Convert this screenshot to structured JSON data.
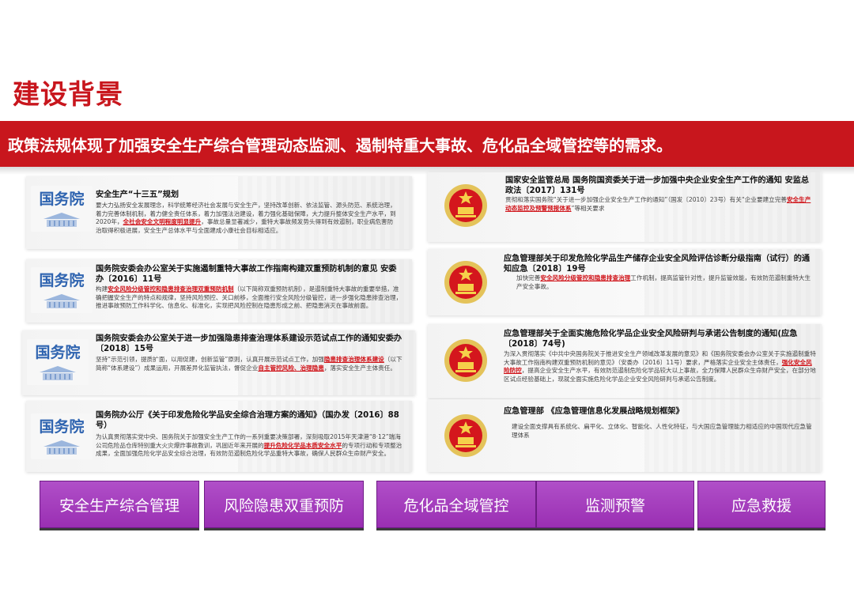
{
  "page": {
    "title": "建设背景",
    "banner": "政策法规体现了加强安全生产综合管理动态监测、遏制特重大事故、危化品全域管控等的需求。"
  },
  "left_cards": [
    {
      "badge": "国务院",
      "title": "安全生产“十三五”规划",
      "body_parts": [
        {
          "t": "要大力弘扬安全发展理念，科学统筹经济社会发展与安全生产，坚持改革创新、依法监管、源头防范、系统治理，着力完善体制机制，着力健全责任体系，着力加强法治建设，着力强化基础保障，大力提升整体安全生产水平，到2020年，",
          "red": false
        },
        {
          "t": "全社会安全文明程度明显提升",
          "red": true
        },
        {
          "t": "，事故总量显著减少，重特大事故频发势头得到有效遏制，职业病危害防治取得积极进展，安全生产总体水平与全面建成小康社会目标相适应。",
          "red": false
        }
      ]
    },
    {
      "badge": "国务院",
      "title": "国务院安委会办公室关于实施遏制重特大事故工作指南构建双重预防机制的意见 安委办〔2016〕11号",
      "body_parts": [
        {
          "t": "构建",
          "red": false
        },
        {
          "t": "安全风险分级管控和隐患排查治理双重预防机制",
          "red": true
        },
        {
          "t": "（以下简称双重预防机制），是遏制重特大事故的重要举措，准确把握安全生产的特点和规律，坚持风险预控、关口前移，全面推行安全风险分级管控，进一步强化隐患排查治理，推进事故预防工作科学化、信息化、标准化，实现把风险控制在隐患形成之前、把隐患消灭在事故前面。",
          "red": false
        }
      ]
    },
    {
      "badge": "国务院",
      "title": "国务院安委会办公室关于进一步加强隐患排查治理体系建设示范试点工作的通知安委办〔2018〕15号",
      "body_parts": [
        {
          "t": "坚持“示范引领，提质扩面，以用促建，创新监管”原则，认真开展示范试点工作，加强",
          "red": false
        },
        {
          "t": "隐患排查治理体系建设",
          "red": true
        },
        {
          "t": "（以下简称“体系建设”）成果运用，开展差异化监管执法，督促企业",
          "red": false
        },
        {
          "t": "自主管控风险、治理隐患",
          "red": true
        },
        {
          "t": "，落实安全生产主体责任。",
          "red": false
        }
      ]
    },
    {
      "badge": "国务院",
      "title": "国务院办公厅《关于印发危险化学品安全综合治理方案的通知》（国办发〔2016〕88号）",
      "body_parts": [
        {
          "t": "为认真贯彻落实党中央、国务院关于加强安全生产工作的一系列重要决策部署，深刻吸取2015年天津港“8·12”瑞海公司危险品仓库特别重大火灾爆炸事故教训，巩固近年来开展的",
          "red": false
        },
        {
          "t": "提升危险化学品本质安全水平",
          "red": true
        },
        {
          "t": "的专项行动和专项整治成果，全面加强危险化学品安全综合治理，有效防范遏制危险化学品重特大事故，确保人民群众生命财产安全。",
          "red": false
        }
      ]
    }
  ],
  "right_cards": [
    {
      "title": "国家安全监管总局 国务院国资委关于进一步加强中央企业安全生产工作的通知 安监总政法〔2017〕131号",
      "body_parts": [
        {
          "t": "贯彻和落实国务院“关于进一步加强企业安全生产工作的通知”（国发〔2010〕23号）有关“企业要建立完善",
          "red": false
        },
        {
          "t": "安全生产动态监控及预警预报体系",
          "red": true
        },
        {
          "t": "”等相关要求",
          "red": false
        }
      ]
    },
    {
      "title": "应急管理部关于印发危险化学品生产储存企业安全风险评估诊断分级指南（试行）的通知应急〔2018〕19号",
      "body_parts": [
        {
          "t": "加快完善",
          "red": false
        },
        {
          "t": "安全风险分级管控和隐患排查治理",
          "red": true
        },
        {
          "t": "工作机制，提高监管针对性，提升监管效能，有效防范遏制重特大生产安全事故。",
          "red": false
        }
      ]
    },
    {
      "title": "应急管理部关于全面实施危险化学品企业安全风险研判与承诺公告制度的通知(应急〔2018〕74号)",
      "body_parts": [
        {
          "t": "为深入贯彻落实《中共中央国务院关于推进安全生产领域改革发展的意见》和《国务院安委会办公室关于实施遏制重特大事故工作指南构建双重预防机制的意见》（安委办〔2016〕11号）要求，严格落实企业安全主体责任，",
          "red": false
        },
        {
          "t": "强化安全风险防控",
          "red": true
        },
        {
          "t": "，提高企业安全生产水平，有效防范遏制危险化学品较大以上事故，全力保障人民群众生命财产安全，在部分地区试点经验基础上，现就全面实施危险化学品企业安全风险研判与承诺公告制度。",
          "red": false
        }
      ]
    },
    {
      "title": "应急管理部 《应急管理信息化发展战略规划框架》",
      "body_parts": [
        {
          "t": "建设全面支撑具有系统化、扁平化、立体化、智能化、人性化特征，与大国应急管理能力相适应的中国现代应急管理体系",
          "red": false
        }
      ]
    }
  ],
  "buttons": [
    "安全生产综合管理",
    "风险隐患双重预防",
    "危化品全域管控",
    "监测预警",
    "应急救援"
  ],
  "colors": {
    "brand_red": "#c8161d",
    "button_purple": "#a43dbd",
    "gov_blue": "#2f64b0"
  }
}
